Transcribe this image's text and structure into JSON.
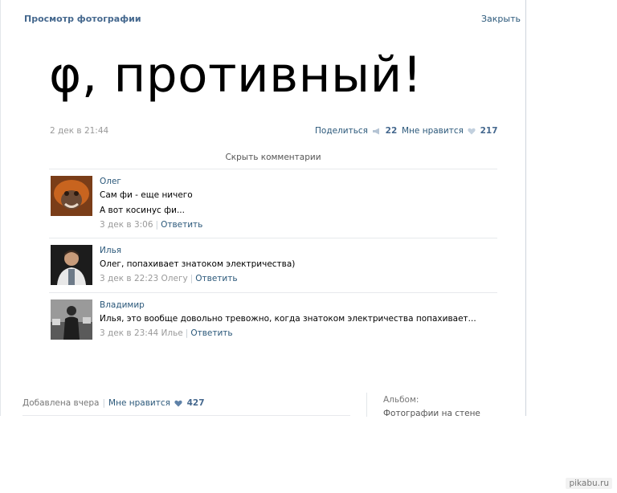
{
  "window": {
    "title": "Просмотр фотографии",
    "close_label": "Закрыть"
  },
  "photo": {
    "text": "φ, противный!"
  },
  "post": {
    "date": "2 дек в 21:44",
    "share_label": "Поделиться",
    "share_count": "22",
    "like_label": "Мне нравится",
    "like_count": "217"
  },
  "comments_toggle": "Скрыть комментарии",
  "comments": [
    {
      "author": "Олег",
      "lines": [
        "Сам фи - еще ничего",
        "А вот косинус фи..."
      ],
      "meta": "3 дек в 3:06",
      "reply": "Ответить"
    },
    {
      "author": "Илья",
      "lines": [
        "Олег, попахивает знатоком электричества)"
      ],
      "meta": "3 дек в 22:23 Олегу",
      "reply": "Ответить"
    },
    {
      "author": "Владимир",
      "lines": [
        "Илья, это вообще довольно тревожно, когда знатоком электричества попахивает..."
      ],
      "meta": "3 дек в 23:44 Илье",
      "reply": "Ответить"
    }
  ],
  "footer": {
    "added": "Добавлена вчера",
    "like_label": "Мне нравится",
    "like_count": "427",
    "album_label": "Альбом:",
    "album_value": "Фотографии на стене"
  },
  "watermark": "pikabu.ru",
  "colors": {
    "link": "#2b587a",
    "title": "#45688e",
    "muted": "#999999"
  },
  "icons": {
    "share": "megaphone-icon",
    "like": "heart-icon"
  }
}
